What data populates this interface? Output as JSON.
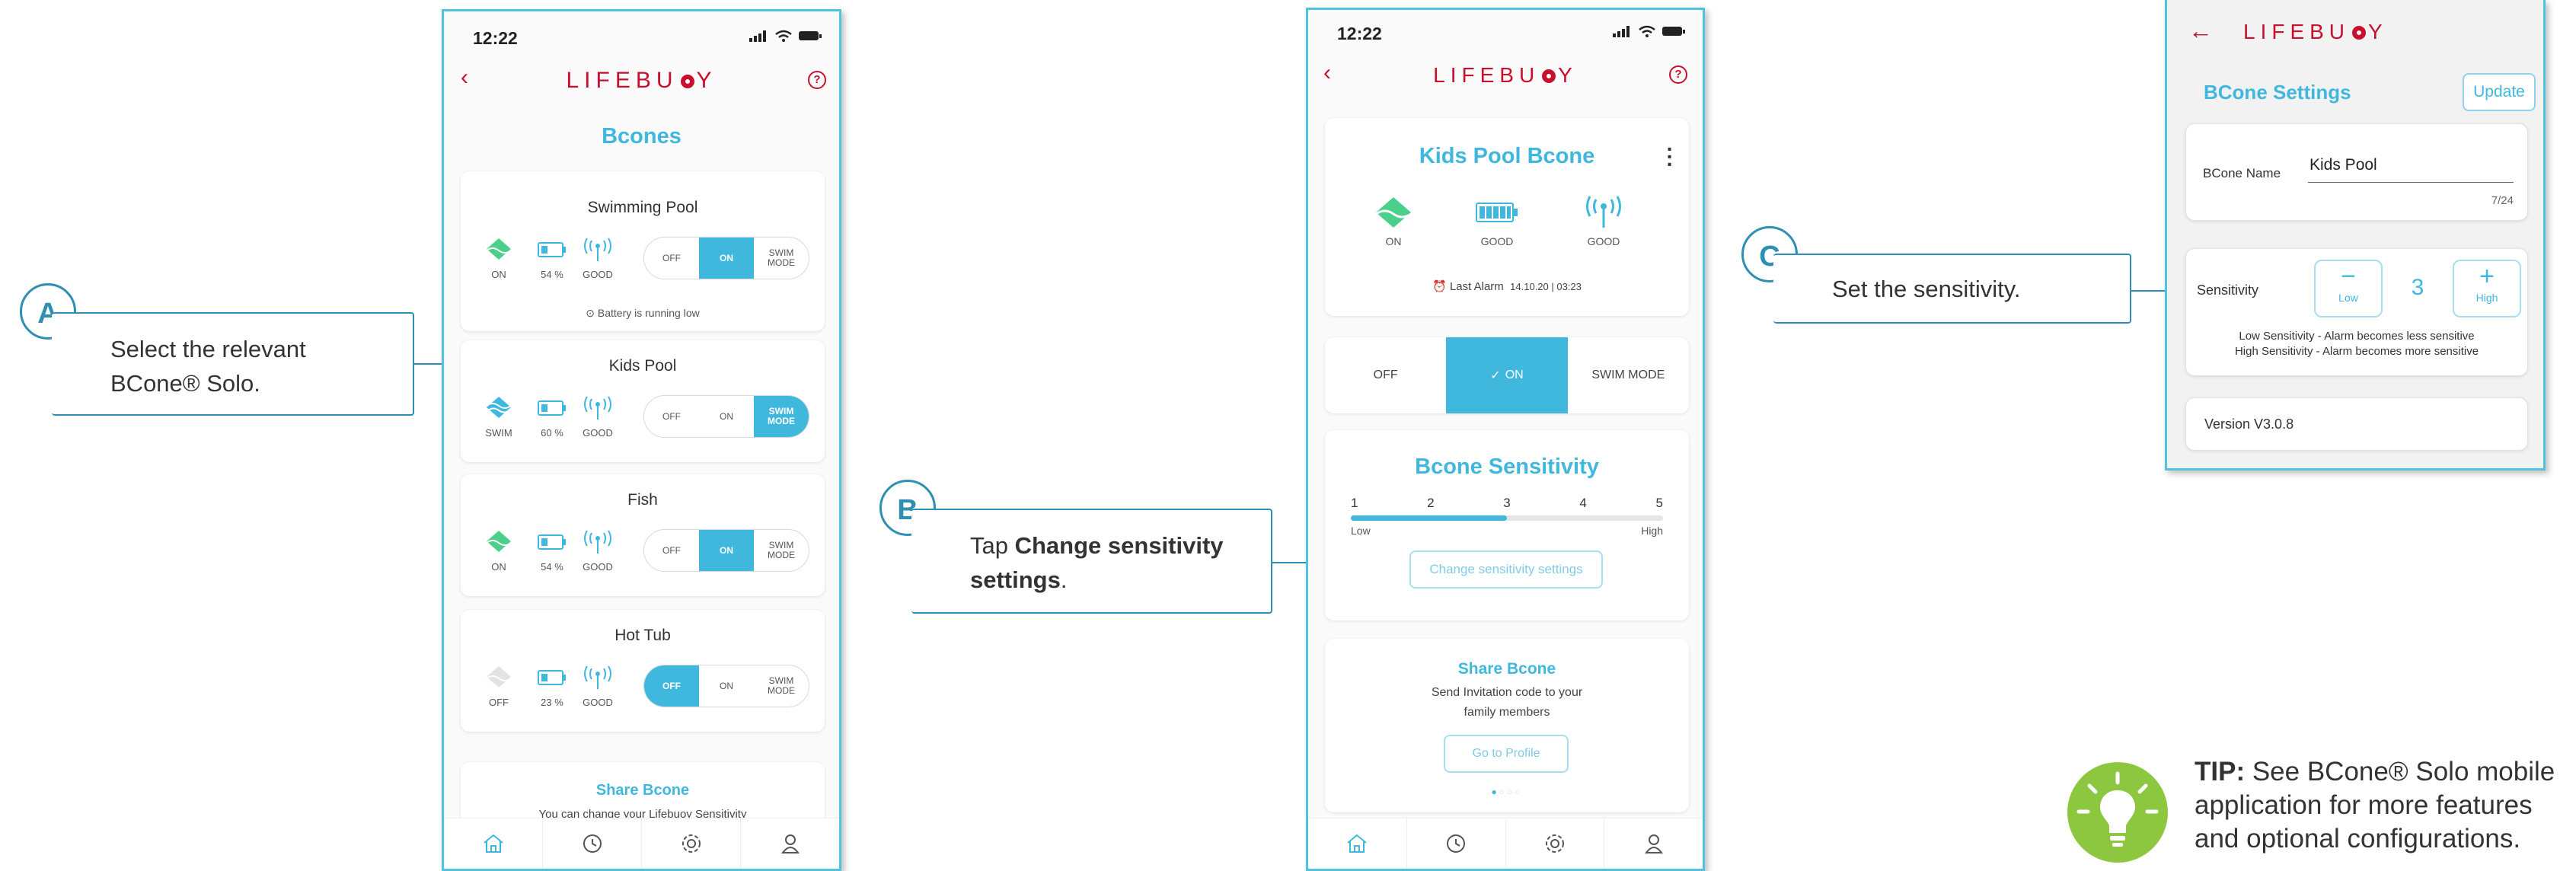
{
  "colors": {
    "accent": "#40b8dd",
    "brand": "#c8102e",
    "callout": "#2e8fb3",
    "tip_green": "#8dc63f"
  },
  "brand": {
    "name_pre": "LIFEBU",
    "name_post": "Y"
  },
  "status_time": "12:22",
  "phone1": {
    "title": "Bcones",
    "devices": [
      {
        "name": "Swimming Pool",
        "state": "ON",
        "battery": "54 %",
        "signal": "GOOD",
        "mode": "ON",
        "note": "Battery is running low"
      },
      {
        "name": "Kids Pool",
        "state": "SWIM",
        "battery": "60 %",
        "signal": "GOOD",
        "mode": "SWIM"
      },
      {
        "name": "Fish",
        "state": "ON",
        "battery": "54 %",
        "signal": "GOOD",
        "mode": "ON"
      },
      {
        "name": "Hot Tub",
        "state": "OFF",
        "battery": "23 %",
        "signal": "GOOD",
        "mode": "OFF"
      }
    ],
    "toggle": {
      "off": "OFF",
      "on": "ON",
      "swim_1": "SWIM",
      "swim_2": "MODE"
    },
    "share": {
      "title": "Share Bcone",
      "text": "You can change your Lifebuoy Sensitivity"
    }
  },
  "phone2": {
    "title": "Kids Pool Bcone",
    "state": "ON",
    "battery": "GOOD",
    "signal": "GOOD",
    "last_alarm": "Last Alarm",
    "last_alarm_value": "14.10.20 | 03:23",
    "mode": {
      "off": "OFF",
      "on": "ON",
      "swim": "SWIM MODE"
    },
    "sensitivity": {
      "title": "Bcone Sensitivity",
      "levels": [
        "1",
        "2",
        "3",
        "4",
        "5"
      ],
      "current": 3,
      "low": "Low",
      "high": "High",
      "button": "Change sensitivity settings"
    },
    "share": {
      "title": "Share Bcone",
      "text1": "Send Invitation code to your",
      "text2": "family members",
      "button": "Go to Profile"
    }
  },
  "panel": {
    "title": "BCone Settings",
    "update": "Update",
    "name_label": "BCone Name",
    "name_value": "Kids Pool",
    "name_counter": "7/24",
    "sens_label": "Sensitivity",
    "sens_value": "3",
    "minus": "−",
    "plus": "+",
    "low": "Low",
    "high": "High",
    "low_desc": "Low Sensitivity - Alarm becomes less sensitive",
    "high_desc": "High Sensitivity - Alarm becomes more sensitive",
    "version": "Version V3.0.8"
  },
  "callouts": {
    "a": {
      "letter": "A",
      "line1": "Select the relevant",
      "line2": "BCone® Solo."
    },
    "b": {
      "letter": "B",
      "pre": "Tap ",
      "bold1": "Change sensitivity",
      "bold2": "settings",
      "post": "."
    },
    "c": {
      "letter": "C",
      "text": "Set the sensitivity."
    }
  },
  "tip": {
    "label": "TIP:",
    "line1": " See BCone® Solo mobile",
    "line2": "application for more features",
    "line3": "and optional configurations."
  }
}
